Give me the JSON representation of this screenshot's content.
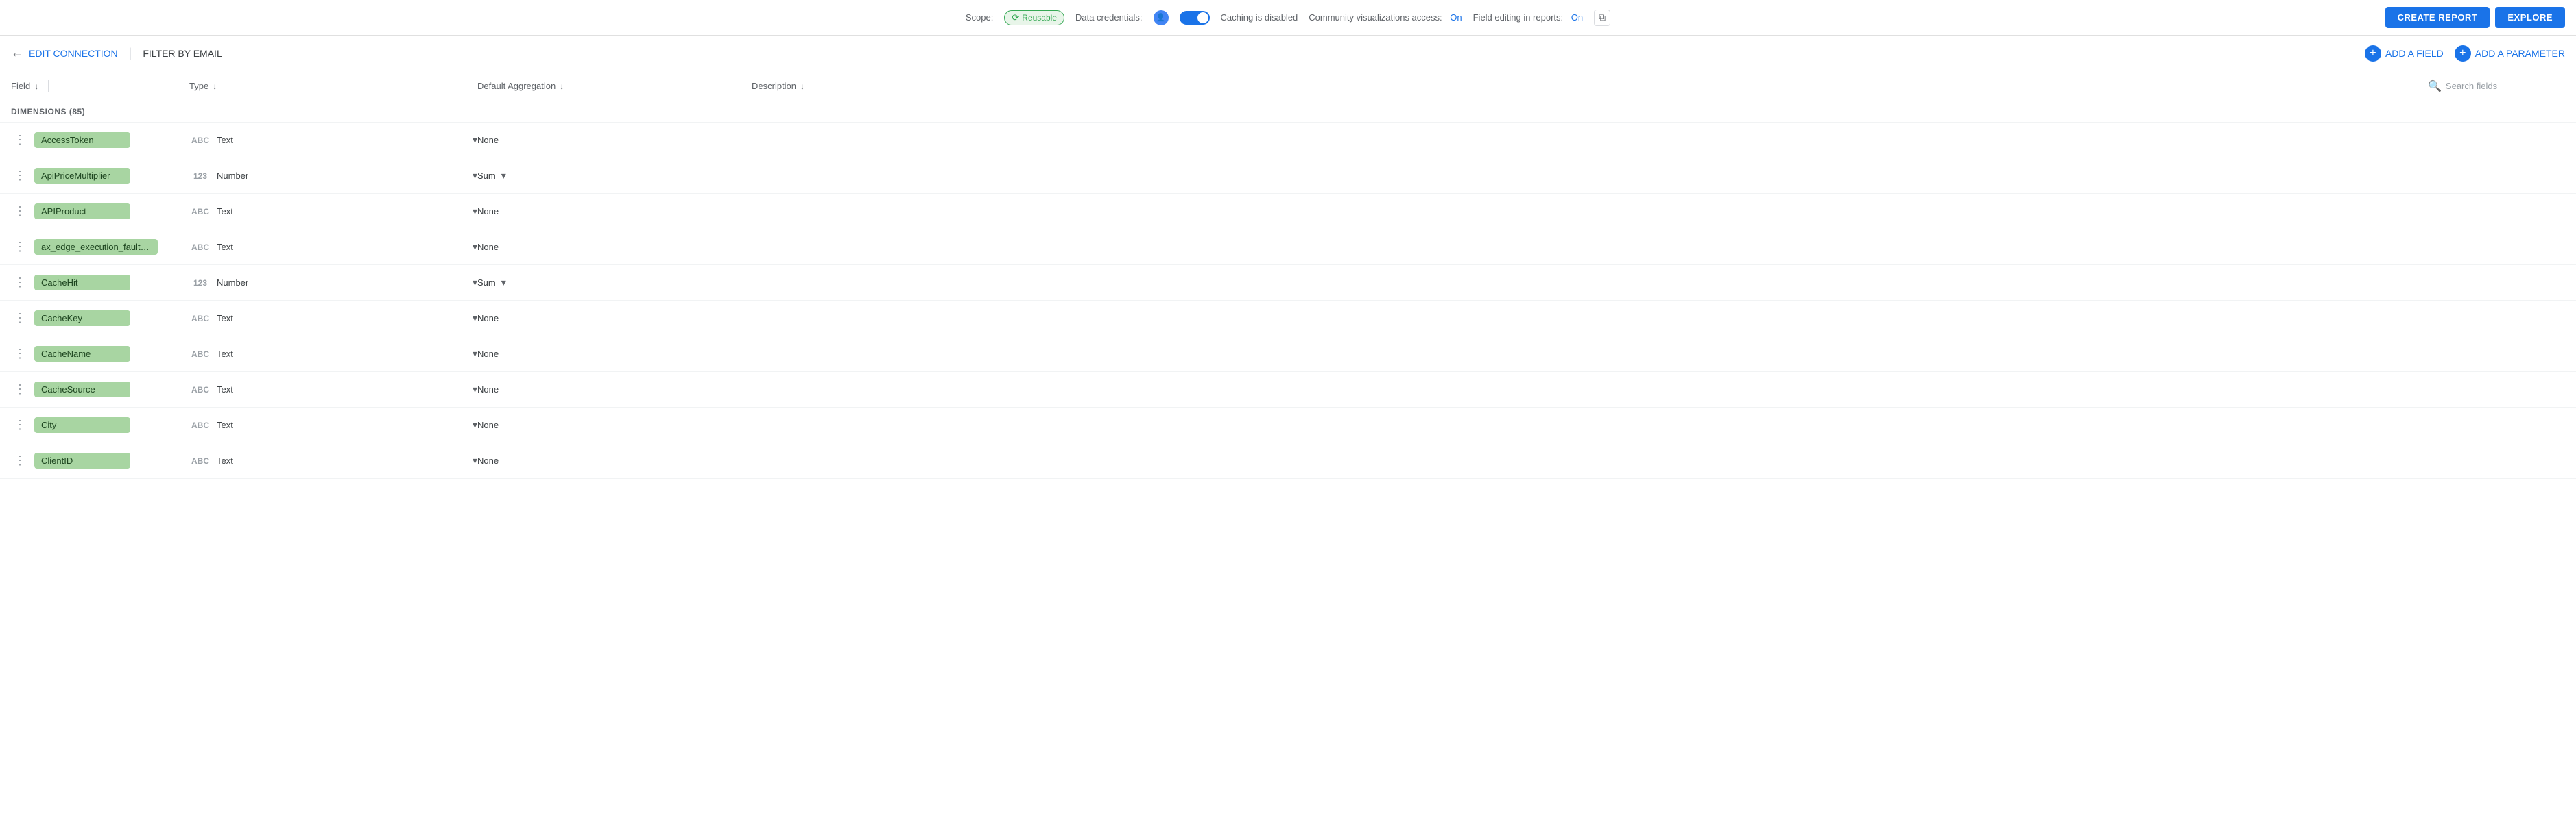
{
  "topBar": {
    "scopeLabel": "Scope:",
    "reusableBadge": "Reusable",
    "dataCredentialsLabel": "Data credentials:",
    "cachingLabel": "Caching is disabled",
    "communityLabel": "Community visualizations access:",
    "communityOn": "On",
    "fieldEditingLabel": "Field editing in reports:",
    "fieldEditingOn": "On",
    "createReportLabel": "CREATE REPORT",
    "exploreLabel": "EXPLORE"
  },
  "secondBar": {
    "backLabel": "EDIT CONNECTION",
    "divider": "|",
    "filterLabel": "FILTER BY EMAIL",
    "addFieldLabel": "ADD A FIELD",
    "addParameterLabel": "ADD A PARAMETER"
  },
  "tableHeader": {
    "fieldLabel": "Field",
    "typeLabel": "Type",
    "aggregationLabel": "Default Aggregation",
    "descriptionLabel": "Description",
    "searchPlaceholder": "Search fields"
  },
  "dimensionsHeader": "DIMENSIONS (85)",
  "rows": [
    {
      "fieldName": "AccessToken",
      "typeIcon": "ABC",
      "typeName": "Text",
      "aggregation": "None",
      "showAggDropdown": false,
      "description": ""
    },
    {
      "fieldName": "ApiPriceMultiplier",
      "typeIcon": "123",
      "typeName": "Number",
      "aggregation": "Sum",
      "showAggDropdown": true,
      "description": ""
    },
    {
      "fieldName": "APIProduct",
      "typeIcon": "ABC",
      "typeName": "Text",
      "aggregation": "None",
      "showAggDropdown": false,
      "description": ""
    },
    {
      "fieldName": "ax_edge_execution_fault_...",
      "typeIcon": "ABC",
      "typeName": "Text",
      "aggregation": "None",
      "showAggDropdown": false,
      "description": ""
    },
    {
      "fieldName": "CacheHit",
      "typeIcon": "123",
      "typeName": "Number",
      "aggregation": "Sum",
      "showAggDropdown": true,
      "description": ""
    },
    {
      "fieldName": "CacheKey",
      "typeIcon": "ABC",
      "typeName": "Text",
      "aggregation": "None",
      "showAggDropdown": false,
      "description": ""
    },
    {
      "fieldName": "CacheName",
      "typeIcon": "ABC",
      "typeName": "Text",
      "aggregation": "None",
      "showAggDropdown": false,
      "description": ""
    },
    {
      "fieldName": "CacheSource",
      "typeIcon": "ABC",
      "typeName": "Text",
      "aggregation": "None",
      "showAggDropdown": false,
      "description": ""
    },
    {
      "fieldName": "City",
      "typeIcon": "ABC",
      "typeName": "Text",
      "aggregation": "None",
      "showAggDropdown": false,
      "description": ""
    },
    {
      "fieldName": "ClientID",
      "typeIcon": "ABC",
      "typeName": "Text",
      "aggregation": "None",
      "showAggDropdown": false,
      "description": ""
    }
  ]
}
